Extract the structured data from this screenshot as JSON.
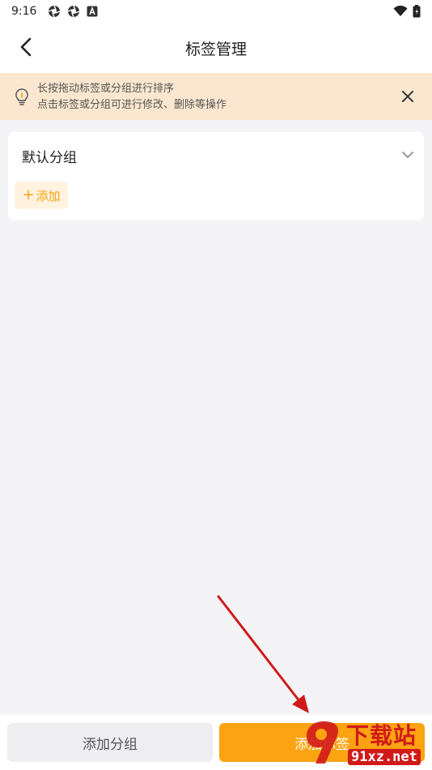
{
  "status_bar": {
    "time": "9:16",
    "left_icons": [
      "aperture-icon",
      "aperture-icon",
      "app-badge-icon"
    ],
    "right_icons": [
      "wifi-icon",
      "battery-icon"
    ]
  },
  "header": {
    "title": "标签管理",
    "back_icon": "chevron-left-icon"
  },
  "tip": {
    "line1": "长按拖动标签或分组进行排序",
    "line2": "点击标签或分组可进行修改、删除等操作",
    "icon": "lightbulb-icon",
    "close_icon": "close-icon"
  },
  "group": {
    "name": "默认分组",
    "toggle_icon": "chevron-down-icon",
    "add_plus": "+",
    "add_label": "添加"
  },
  "bottom": {
    "add_group_label": "添加分组",
    "add_tag_label": "添加标签"
  },
  "watermark": {
    "text": "下载站",
    "url": "91xz.net"
  },
  "colors": {
    "accent": "#fca311",
    "tip_bg": "#fbe7cf",
    "chip_bg": "#fff3e0",
    "chip_text": "#f5a20a",
    "page_bg": "#f4f4f6",
    "arrow": "#d01a1a"
  }
}
